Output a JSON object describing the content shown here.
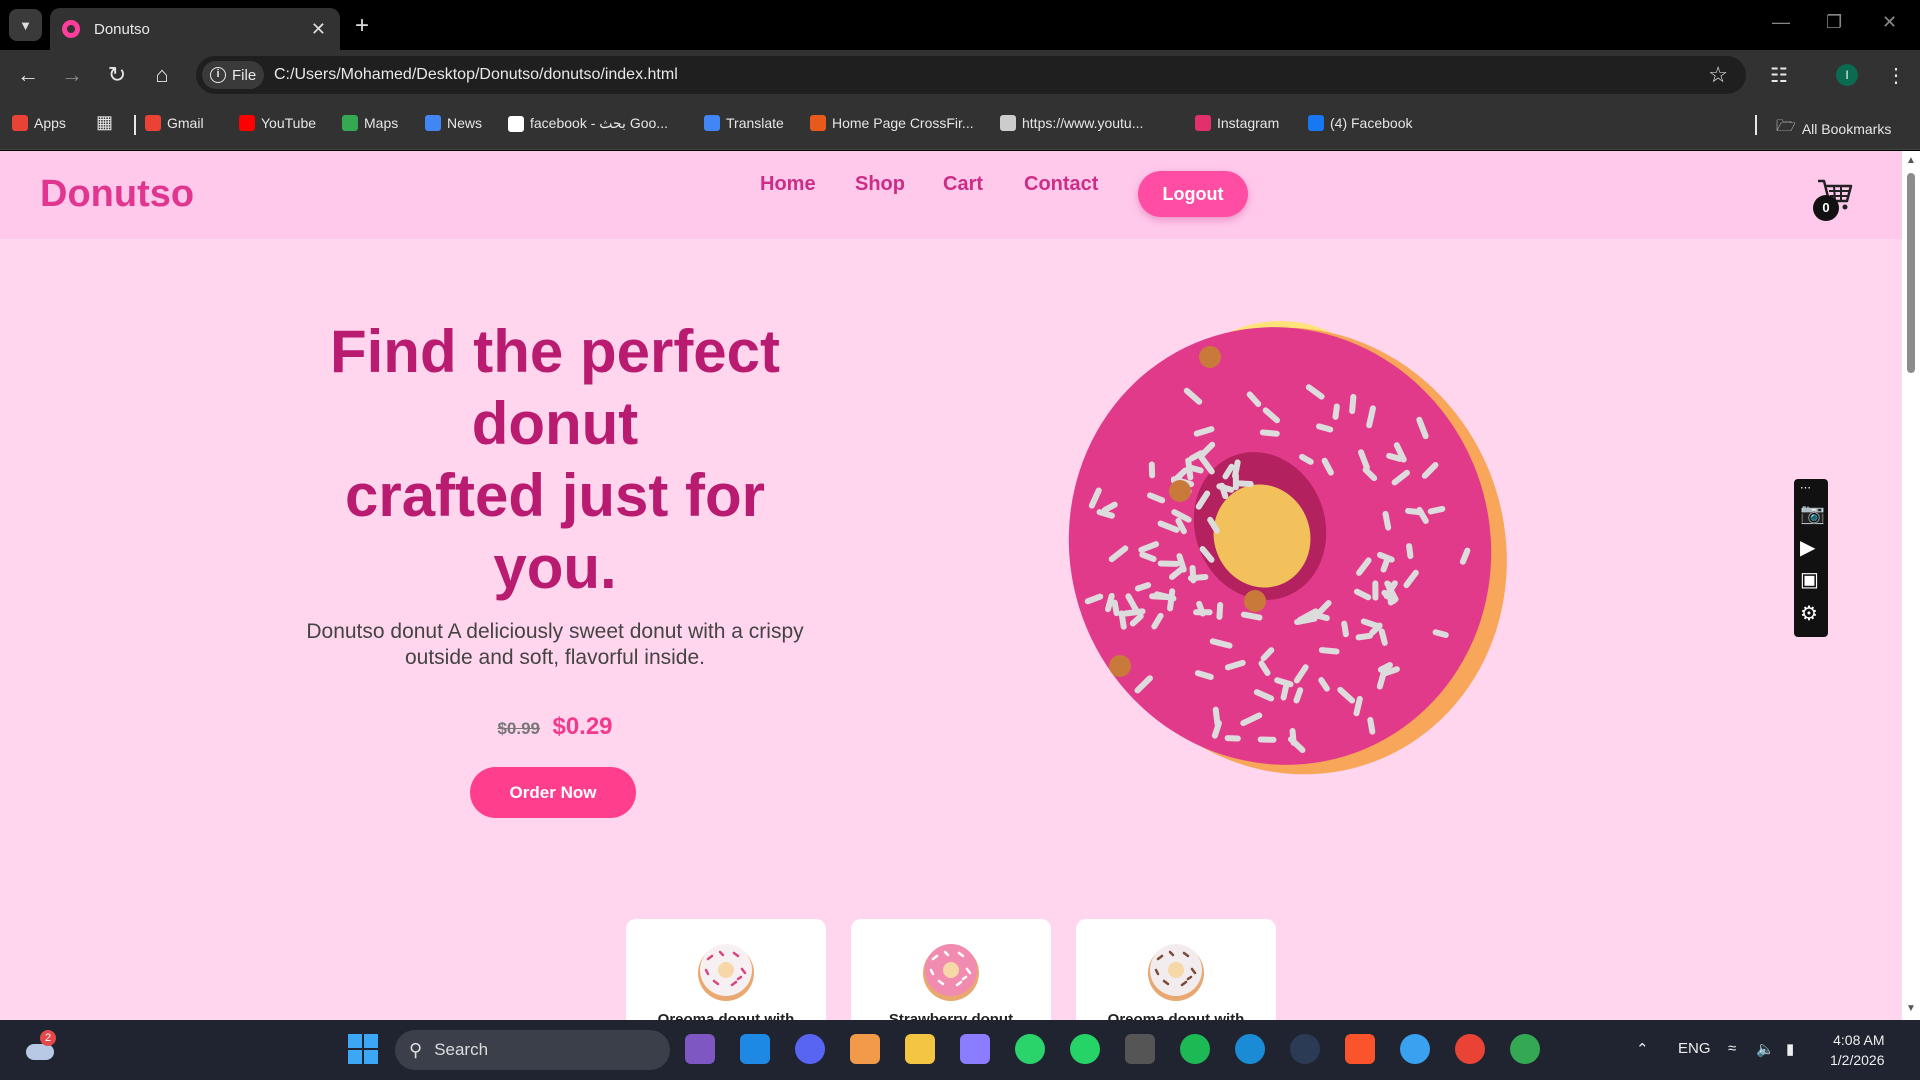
{
  "browser": {
    "tab_title": "Donutso",
    "url": "C:/Users/Mohamed/Desktop/Donutso/donutso/index.html",
    "url_chip": "File",
    "bookmarks": [
      {
        "label": "Apps",
        "color": "#e94335"
      },
      {
        "label": "Gmail",
        "color": "#ea4335"
      },
      {
        "label": "YouTube",
        "color": "#ff0000"
      },
      {
        "label": "Maps",
        "color": "#34a853"
      },
      {
        "label": "News",
        "color": "#4285f4"
      },
      {
        "label": "facebook - بحث Goo...",
        "color": "#ffffff"
      },
      {
        "label": "Translate",
        "color": "#4285f4"
      },
      {
        "label": "Home Page CrossFir...",
        "color": "#e85a1b"
      },
      {
        "label": "https://www.youtu...",
        "color": "#cccccc"
      },
      {
        "label": "Instagram",
        "color": "#e1306c"
      },
      {
        "label": "(4) Facebook",
        "color": "#1877f2"
      }
    ],
    "all_bookmarks": "All Bookmarks",
    "profile_initial": "I"
  },
  "site": {
    "logo": "Donutso",
    "nav": [
      "Home",
      "Shop",
      "Cart",
      "Contact"
    ],
    "logout": "Logout",
    "cart_count": "0",
    "hero": {
      "title_line1": "Find the perfect",
      "title_line2": "donut",
      "title_line3": "crafted just for",
      "title_line4": "you.",
      "description": "Donutso donut A deliciously sweet donut with a crispy outside and soft, flavorful inside.",
      "price_old": "$0.99",
      "price_new": "$0.29",
      "order_button": "Order Now"
    },
    "cards": [
      {
        "title": "Oreoma donut with",
        "frosting": "#f7f0f3",
        "sprinkles": "#d9467f"
      },
      {
        "title": "Strawberry donut",
        "frosting": "#f28bb0",
        "sprinkles": "#ffffff"
      },
      {
        "title": "Oreoma donut with",
        "frosting": "#f3ecef",
        "sprinkles": "#7a4a3a"
      }
    ]
  },
  "taskbar": {
    "search": "Search",
    "language": "ENG",
    "time": "4:08 AM",
    "date": "1/2/2026",
    "weather_badge": "2"
  },
  "colors": {
    "page_bg": "#ffd6ee",
    "header_bg": "#ffc9ec",
    "accent": "#ff3f8e",
    "title": "#b81b6f"
  }
}
